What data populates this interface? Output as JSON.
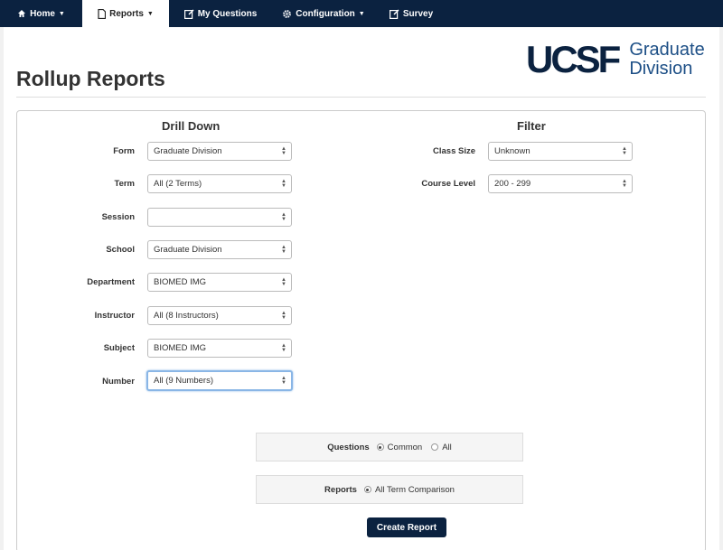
{
  "nav": {
    "home": "Home",
    "reports": "Reports",
    "my_questions": "My Questions",
    "configuration": "Configuration",
    "survey": "Survey"
  },
  "logo": {
    "mark": "UCSF",
    "line1": "Graduate",
    "line2": "Division"
  },
  "page_title": "Rollup Reports",
  "drill_down": {
    "heading": "Drill Down",
    "fields": [
      {
        "label": "Form",
        "value": "Graduate Division"
      },
      {
        "label": "Term",
        "value": "All (2 Terms)"
      },
      {
        "label": "Session",
        "value": ""
      },
      {
        "label": "School",
        "value": "Graduate Division"
      },
      {
        "label": "Department",
        "value": "BIOMED IMG"
      },
      {
        "label": "Instructor",
        "value": "All (8 Instructors)"
      },
      {
        "label": "Subject",
        "value": "BIOMED IMG"
      },
      {
        "label": "Number",
        "value": "All (9 Numbers)"
      }
    ]
  },
  "filter": {
    "heading": "Filter",
    "fields": [
      {
        "label": "Class Size",
        "value": "Unknown"
      },
      {
        "label": "Course Level",
        "value": "200 - 299"
      }
    ]
  },
  "questions": {
    "label": "Questions",
    "options": [
      "Common",
      "All"
    ],
    "selected": "Common"
  },
  "reports": {
    "label": "Reports",
    "options": [
      "All Term Comparison"
    ],
    "selected": "All Term Comparison"
  },
  "create_button": "Create Report",
  "colors": {
    "navbar": "#0b2240",
    "brand": "#0b2240",
    "focus": "#8ab6e6"
  }
}
